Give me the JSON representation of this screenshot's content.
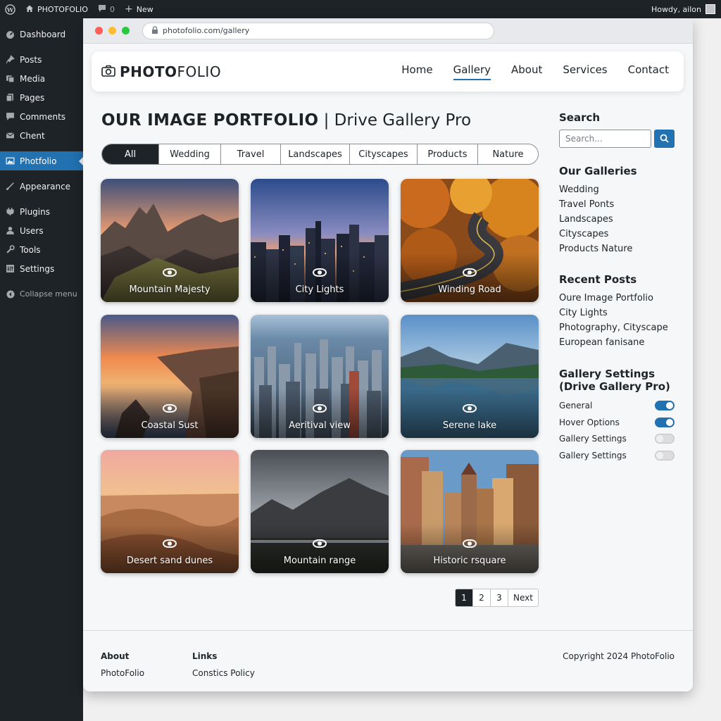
{
  "adminbar": {
    "site_name": "PHOTOFOLIO",
    "comments_count": "0",
    "new_label": "New",
    "howdy": "Howdy, ailon"
  },
  "adminmenu": {
    "items": [
      {
        "label": "Dashboard",
        "icon": "dashboard-icon"
      },
      {
        "label": "Posts",
        "icon": "pin-icon"
      },
      {
        "label": "Media",
        "icon": "media-icon"
      },
      {
        "label": "Pages",
        "icon": "pages-icon"
      },
      {
        "label": "Comments",
        "icon": "comment-icon"
      },
      {
        "label": "Chent",
        "icon": "mail-icon"
      },
      {
        "label": "Photfolio",
        "icon": "gallery-icon"
      },
      {
        "label": "Appearance",
        "icon": "brush-icon"
      },
      {
        "label": "Plugins",
        "icon": "plugin-icon"
      },
      {
        "label": "Users",
        "icon": "users-icon"
      },
      {
        "label": "Tools",
        "icon": "wrench-icon"
      },
      {
        "label": "Settings",
        "icon": "settings-icon"
      }
    ],
    "collapse_label": "Collapse menu"
  },
  "browser": {
    "url": "photofolio.com/gallery"
  },
  "site": {
    "logo_bold": "PHOTO",
    "logo_rest": "FOLIO",
    "nav": [
      "Home",
      "Gallery",
      "About",
      "Services",
      "Contact"
    ],
    "active_nav": "Gallery"
  },
  "main": {
    "title_bold": "OUR IMAGE PORTFOLIO",
    "title_sep": "|",
    "title_rest": "Drive Gallery Pro",
    "filters": [
      "All",
      "Wedding",
      "Travel",
      "Landscapes",
      "Cityscapes",
      "Products",
      "Nature"
    ],
    "active_filter": "All",
    "gallery": [
      {
        "caption": "Mountain Majesty"
      },
      {
        "caption": "City Lights"
      },
      {
        "caption": "Winding Road"
      },
      {
        "caption": "Coastal Sust"
      },
      {
        "caption": "Aeritival view"
      },
      {
        "caption": "Serene lake"
      },
      {
        "caption": "Desert sand dunes"
      },
      {
        "caption": "Mountain range"
      },
      {
        "caption": "Historic rsquare"
      }
    ],
    "pagination": [
      "1",
      "2",
      "3",
      "Next"
    ],
    "current_page": "1"
  },
  "sidebar": {
    "search_title": "Search",
    "search_placeholder": "Search...",
    "galleries_title": "Our Galleries",
    "galleries": [
      "Wedding",
      "Travel Ponts",
      "Landscapes",
      "Cityscapes",
      "Products Nature"
    ],
    "recent_title": "Recent Posts",
    "recent": [
      "Oure Image Portfolio",
      "City Lights",
      "Photography, Cityscape",
      "European fanisane"
    ],
    "settings_title_1": "Gallery Settings",
    "settings_title_2": "(Drive Gallery Pro)",
    "settings": [
      {
        "label": "General",
        "on": true
      },
      {
        "label": "Hover Options",
        "on": true
      },
      {
        "label": "Gallery Settings",
        "on": false
      },
      {
        "label": "Gallery Settings",
        "on": false
      }
    ]
  },
  "footer": {
    "about_title": "About",
    "about_link": "PhotoFolio",
    "links_title": "Links",
    "links_link": "Constics Policy",
    "copyright": "Copyright 2024 PhotoFolio"
  },
  "colors": {
    "wp_dark": "#1d2327",
    "accent": "#2271b1"
  }
}
